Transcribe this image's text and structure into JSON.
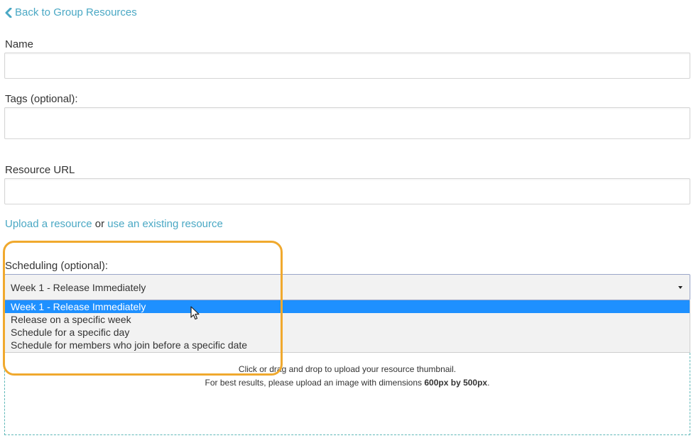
{
  "back_link": {
    "label": "Back to Group Resources",
    "icon": "chevron-left-icon"
  },
  "fields": {
    "name": {
      "label": "Name",
      "value": ""
    },
    "tags": {
      "label": "Tags (optional):",
      "value": ""
    },
    "resource_url": {
      "label": "Resource URL",
      "value": ""
    }
  },
  "upload": {
    "upload_link": "Upload a resource",
    "or_text": " or ",
    "existing_link": "use an existing resource"
  },
  "scheduling": {
    "label": "Scheduling (optional):",
    "selected_value": "Week 1 - Release Immediately",
    "options": [
      "Week 1 - Release Immediately",
      "Release on a specific week",
      "Schedule for a specific day",
      "Schedule for members who join before a specific date"
    ]
  },
  "dropzone": {
    "line1": "Click or drag and drop to upload your resource thumbnail.",
    "line2_prefix": "For best results, please upload an image with dimensions ",
    "line2_bold": "600px by 500px",
    "line2_suffix": "."
  },
  "colors": {
    "link": "#4aa8c4",
    "highlight": "#f0a92e",
    "option_selected_bg": "#1e90ff",
    "dropzone_border": "#5fb8b8"
  }
}
